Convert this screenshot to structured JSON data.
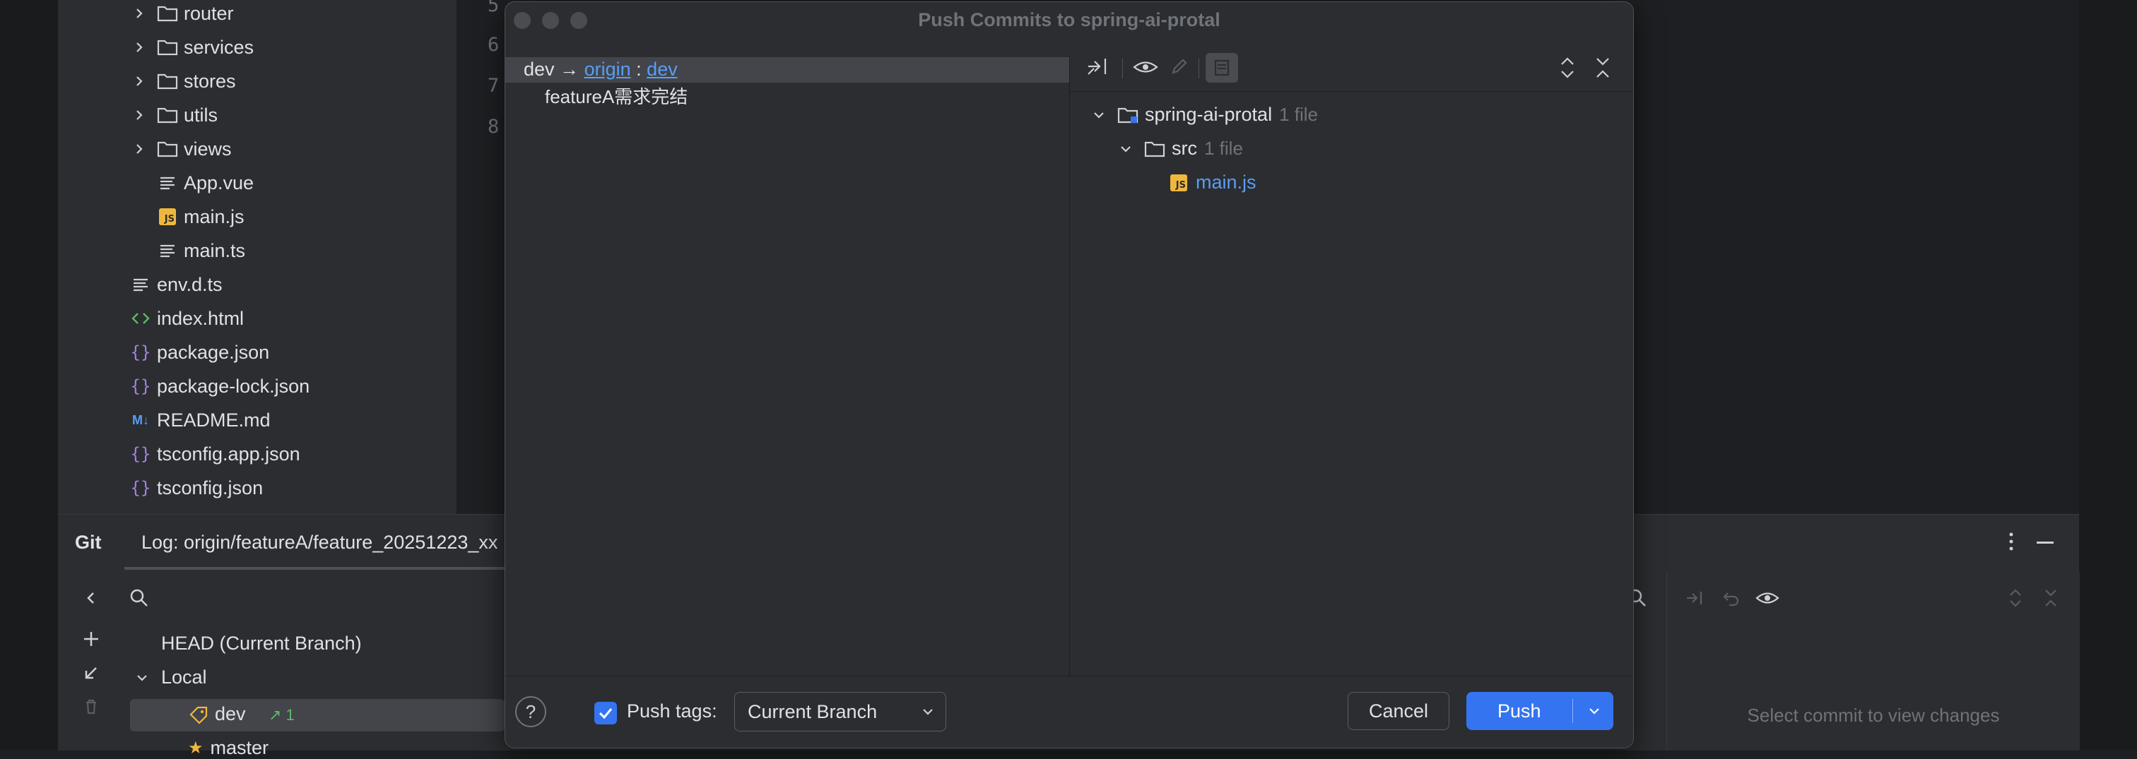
{
  "project_tree": {
    "items": [
      {
        "label": "router",
        "kind": "folder",
        "collapsible": true
      },
      {
        "label": "services",
        "kind": "folder",
        "collapsible": true
      },
      {
        "label": "stores",
        "kind": "folder",
        "collapsible": true
      },
      {
        "label": "utils",
        "kind": "folder",
        "collapsible": true
      },
      {
        "label": "views",
        "kind": "folder",
        "collapsible": true
      },
      {
        "label": "App.vue",
        "kind": "text-file"
      },
      {
        "label": "main.js",
        "kind": "js-file"
      },
      {
        "label": "main.ts",
        "kind": "text-file"
      },
      {
        "label": "env.d.ts",
        "kind": "text-file"
      },
      {
        "label": "index.html",
        "kind": "html-file"
      },
      {
        "label": "package.json",
        "kind": "json-file"
      },
      {
        "label": "package-lock.json",
        "kind": "json-file"
      },
      {
        "label": "README.md",
        "kind": "markdown-file"
      },
      {
        "label": "tsconfig.app.json",
        "kind": "json-file"
      },
      {
        "label": "tsconfig.json",
        "kind": "json-file"
      }
    ]
  },
  "editor": {
    "line_numbers": [
      "5",
      "6",
      "7",
      "8"
    ]
  },
  "git_panel": {
    "title": "Git",
    "log_tab": "Log: origin/featureA/feature_20251223_xx",
    "head_label": "HEAD (Current Branch)",
    "local_label": "Local",
    "branches": [
      {
        "name": "dev",
        "ahead": "↗ 1"
      },
      {
        "name": "master",
        "ahead": ""
      }
    ],
    "select_commit_hint": "Select commit to view changes"
  },
  "dialog": {
    "title": "Push Commits to spring-ai-protal",
    "push_target": {
      "local": "dev",
      "arrow": "→",
      "remote": "origin",
      "separator": ":",
      "remote_branch": "dev"
    },
    "commits": [
      "featureA需求完结"
    ],
    "changes_tree": {
      "root": {
        "label": "spring-ai-protal",
        "count": "1 file"
      },
      "folder": {
        "label": "src",
        "count": "1 file"
      },
      "file": {
        "label": "main.js"
      }
    },
    "footer": {
      "help_label": "?",
      "push_tags_label": "Push tags:",
      "push_tags_checked": true,
      "push_tags_option": "Current Branch",
      "cancel_label": "Cancel",
      "push_label": "Push"
    }
  },
  "colors": {
    "accent": "#3574f0",
    "link": "#589df6",
    "js_badge": "#f0b73e",
    "green": "#5fb865"
  }
}
